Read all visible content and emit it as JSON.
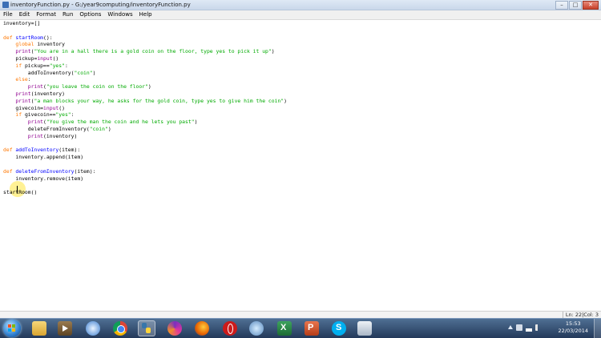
{
  "window": {
    "title": "inventoryFunction.py - G:/year9computing/inventoryFunction.py",
    "controls": {
      "minimize": "–",
      "maximize": "□",
      "close": "✕"
    }
  },
  "menu": [
    "File",
    "Edit",
    "Format",
    "Run",
    "Options",
    "Windows",
    "Help"
  ],
  "code": {
    "l1": "inventory=[]",
    "l3_def": "def ",
    "l3_name": "startRoom",
    "l3_rest": "():",
    "l4_kw": "global",
    "l4_rest": " inventory",
    "l5_fn": "print",
    "l5_a": "(",
    "l5_str": "\"You are in a hall there is a gold coin on the floor, type yes to pick it up\"",
    "l5_b": ")",
    "l6_a": "pickup=",
    "l6_fn": "input",
    "l6_b": "()",
    "l7_kw": "if",
    "l7_a": " pickup==",
    "l7_str": "\"yes\"",
    "l7_b": ":",
    "l8_a": "addToInventory(",
    "l8_str": "\"coin\"",
    "l8_b": ")",
    "l9_kw": "else",
    "l9_b": ":",
    "l10_fn": "print",
    "l10_a": "(",
    "l10_str": "\"you leave the coin on the floor\"",
    "l10_b": ")",
    "l11_fn": "print",
    "l11_rest": "(inventory)",
    "l12_fn": "print",
    "l12_a": "(",
    "l12_str": "\"a man blocks your way, he asks for the gold coin, type yes to give him the coin\"",
    "l12_b": ")",
    "l13_a": "givecoin=",
    "l13_fn": "input",
    "l13_b": "()",
    "l14_kw": "if",
    "l14_a": " givecoin==",
    "l14_str": "\"yes\"",
    "l14_b": ":",
    "l15_fn": "print",
    "l15_a": "(",
    "l15_str": "\"You give the man the coin and he lets you past\"",
    "l15_b": ")",
    "l16_a": "deleteFromInventory(",
    "l16_str": "\"coin\"",
    "l16_b": ")",
    "l17_fn": "print",
    "l17_rest": "(inventory)",
    "l19_def": "def ",
    "l19_name": "addToInventory",
    "l19_rest": "(item):",
    "l20": "inventory.append(item)",
    "l22_def": "def ",
    "l22_name": "deleteFromInventory",
    "l22_rest": "(item):",
    "l23": "inventory.remove(item)",
    "l25": "startRoom()"
  },
  "status": {
    "position": "Ln: 22|Col: 3"
  },
  "taskbar": {
    "clock_time": "15:53",
    "clock_date": "22/03/2014",
    "apps": [
      "file-explorer",
      "media-player",
      "safari",
      "chrome",
      "python-idle",
      "app-swirl",
      "firefox",
      "opera",
      "globe",
      "excel",
      "powerpoint",
      "skype",
      "document"
    ]
  },
  "colors": {
    "keyword": "#ff7700",
    "builtin": "#900090",
    "string": "#00aa00",
    "definition": "#0000ff",
    "taskbar": "#2c4466"
  }
}
